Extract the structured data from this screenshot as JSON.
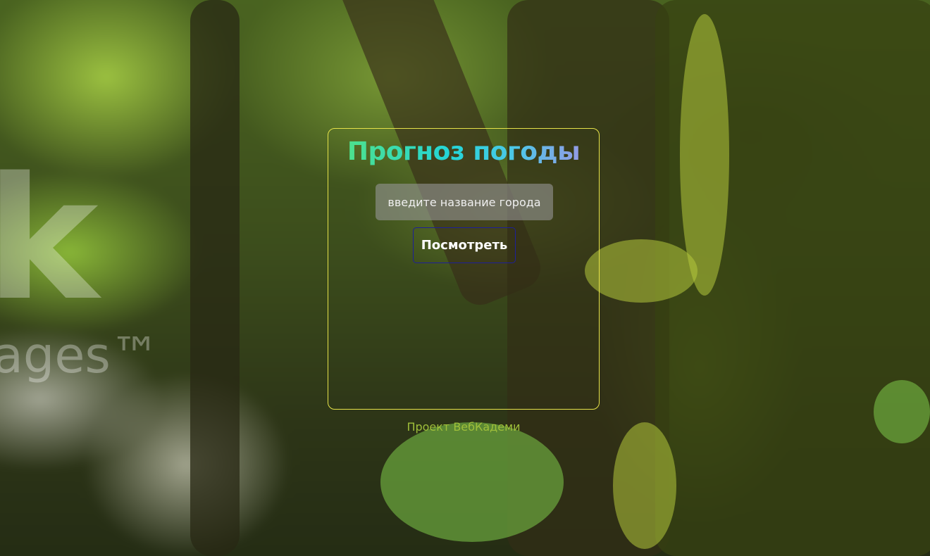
{
  "background": {
    "watermark_main": "k",
    "watermark_sub": "ages™"
  },
  "weather_card": {
    "title": "Прогноз погоды",
    "city_input": {
      "value": "",
      "placeholder": "введите название города"
    },
    "submit_label": "Посмотреть"
  },
  "footer": {
    "credit_link": "Проект ВебКадеми"
  },
  "colors": {
    "card_border": "#e6e24a",
    "button_border": "#1d1f9a",
    "title_gradient": [
      "#55e37e",
      "#23d6d8",
      "#a88ee4"
    ],
    "footer_link": "#9fbf3a"
  }
}
